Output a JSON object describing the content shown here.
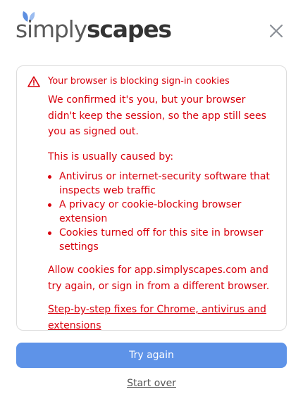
{
  "header": {
    "logo_text_light": "simply",
    "logo_text_bold": "scapes",
    "close_icon": "close-icon"
  },
  "alert": {
    "icon": "warning-triangle-icon",
    "title": "Your browser is blocking sign-in cookies",
    "message": "We confirmed it's you, but your browser didn't keep the session, so the app still sees you as signed out.",
    "causes_intro": "This is usually caused by:",
    "causes": [
      "Antivirus or internet-security software that inspects web traffic",
      "A privacy or cookie-blocking browser extension",
      "Cookies turned off for this site in browser settings"
    ],
    "advice": "Allow cookies for app.simplyscapes.com and try again, or sign in from a different browser.",
    "help_link": "Step-by-step fixes for Chrome, antivirus and extensions"
  },
  "actions": {
    "try_again": "Try again",
    "start_over": "Start over"
  },
  "colors": {
    "error": "#d8000c",
    "primary_button": "#5e93e8",
    "logo_leaf": "#6f9be8"
  }
}
